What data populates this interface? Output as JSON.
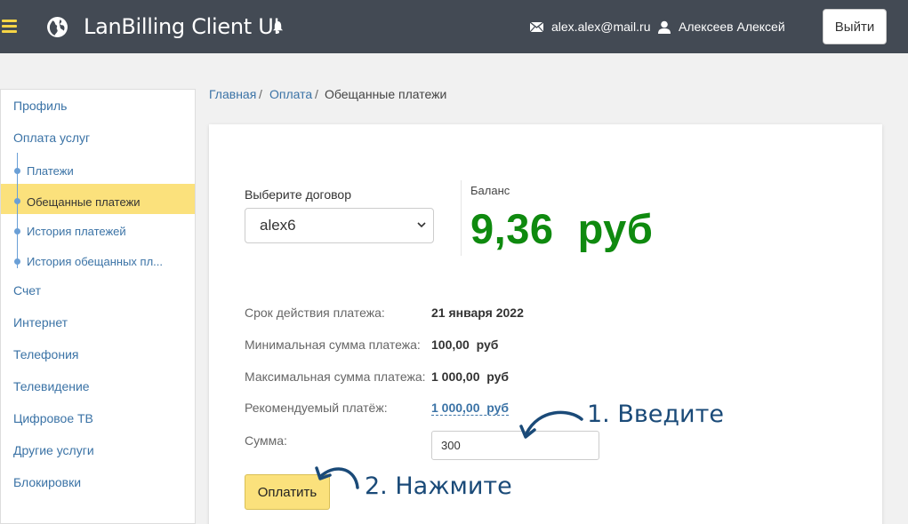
{
  "header": {
    "app_title": "LanBilling Client UI",
    "email": "alex.alex@mail.ru",
    "user_name": "Алексеев Алексей",
    "logout_label": "Выйти"
  },
  "sidebar": {
    "items": [
      {
        "label": "Профиль"
      },
      {
        "label": "Оплата услуг"
      },
      {
        "label": "Платежи"
      },
      {
        "label": "Обещанные платежи"
      },
      {
        "label": "История платежей"
      },
      {
        "label": "История обещанных пл..."
      },
      {
        "label": "Счет"
      },
      {
        "label": "Интернет"
      },
      {
        "label": "Телефония"
      },
      {
        "label": "Телевидение"
      },
      {
        "label": "Цифровое ТВ"
      },
      {
        "label": "Другие услуги"
      },
      {
        "label": "Блокировки"
      }
    ]
  },
  "breadcrumb": {
    "home": "Главная",
    "payment": "Оплата",
    "current": "Обещанные платежи",
    "separator": "/"
  },
  "contract": {
    "label": "Выберите договор",
    "selected": "alex6"
  },
  "balance": {
    "label": "Баланс",
    "value": "9,36  руб"
  },
  "details": [
    {
      "label": "Срок действия платежа:",
      "value": "21 января 2022"
    },
    {
      "label": "Минимальная сумма платежа:",
      "value": "100,00  руб"
    },
    {
      "label": "Максимальная сумма платежа:",
      "value": "1 000,00  руб"
    },
    {
      "label": "Рекомендуемый платёж:",
      "value": "1 000,00  руб"
    }
  ],
  "amount": {
    "label": "Сумма:",
    "value": "300"
  },
  "pay_button": "Оплатить",
  "annotations": {
    "step1": "1. Введите",
    "step2": "2. Нажмите"
  },
  "colors": {
    "header_bg": "#434a54",
    "accent_yellow": "#fbe17c",
    "balance_green": "#0f8a0f",
    "link_blue": "#3b73a6",
    "annotation_blue": "#1a4a78"
  }
}
